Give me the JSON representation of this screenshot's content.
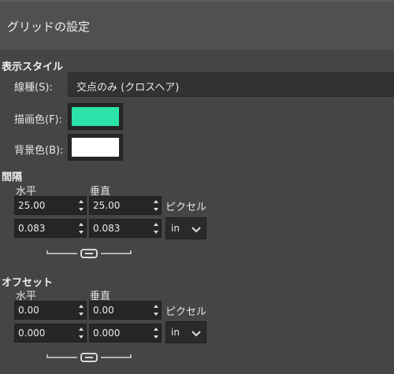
{
  "header": {
    "title": "グリッドの設定"
  },
  "appearance": {
    "section_label": "表示スタイル",
    "line_style_label": "線種(S):",
    "line_style_value": "交点のみ (クロスヘア)",
    "fg_label": "描画色(F):",
    "bg_label": "背景色(B):",
    "fg_color": "#2be3a8",
    "bg_color": "#ffffff"
  },
  "spacing": {
    "section_label": "間隔",
    "horizontal_label": "水平",
    "vertical_label": "垂直",
    "h_pixels": "25.00",
    "v_pixels": "25.00",
    "pixels_unit": "ピクセル",
    "h_units": "0.083",
    "v_units": "0.083",
    "unit_select": "in"
  },
  "offset": {
    "section_label": "オフセット",
    "horizontal_label": "水平",
    "vertical_label": "垂直",
    "h_pixels": "0.00",
    "v_pixels": "0.00",
    "pixels_unit": "ピクセル",
    "h_units": "0.000",
    "v_units": "0.000",
    "unit_select": "in"
  }
}
